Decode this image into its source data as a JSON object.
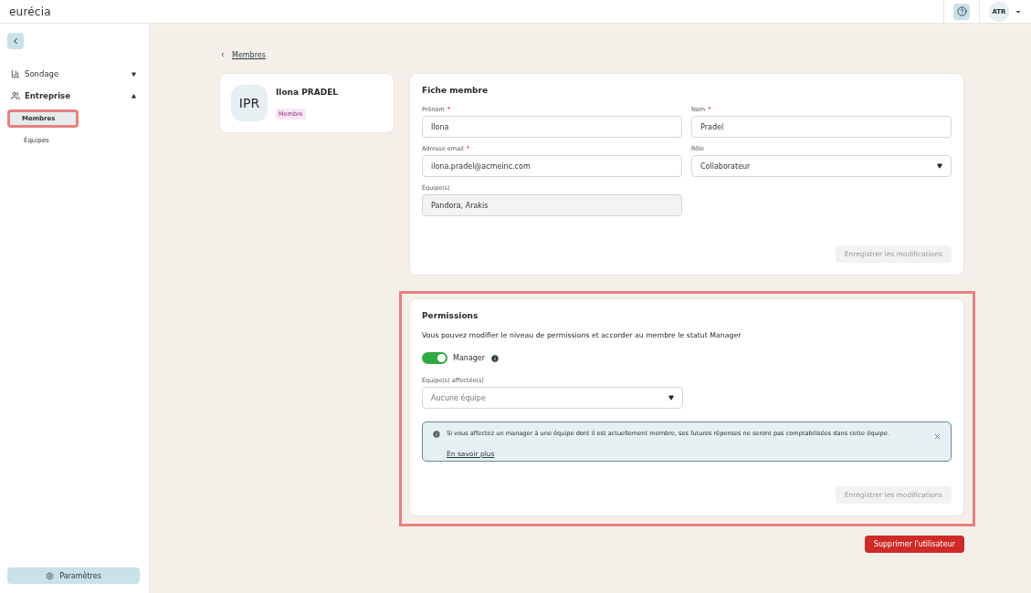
{
  "header": {
    "logo": "eurécia",
    "user_initials": "ATR"
  },
  "sidebar": {
    "items": [
      {
        "label": "Sondage",
        "expanded": false
      },
      {
        "label": "Entreprise",
        "expanded": true,
        "children": [
          {
            "label": "Membres",
            "selected": true,
            "highlighted": true
          },
          {
            "label": "Équipes",
            "selected": false,
            "highlighted": false
          }
        ]
      }
    ],
    "settings": "Paramètres"
  },
  "breadcrumb": "Membres",
  "profile": {
    "initials": "IPR",
    "name": "Ilona PRADEL",
    "badge": "Membre"
  },
  "member_form": {
    "title": "Fiche membre",
    "fields": [
      {
        "label": "Prénom",
        "required_mark": "*",
        "value": "Ilona",
        "kind": "text",
        "disabled": false
      },
      {
        "label": "Nom",
        "required_mark": "*",
        "value": "Pradel",
        "kind": "text",
        "disabled": false
      },
      {
        "label": "Adresse email",
        "required_mark": "*",
        "value": "ilona.pradel@acmeinc.com",
        "kind": "text",
        "disabled": false
      },
      {
        "label": "Rôle",
        "value": "Collaborateur",
        "kind": "select",
        "disabled": false
      },
      {
        "label": "Équipe(s)",
        "value": "Pandora, Arakis",
        "kind": "text",
        "disabled": true
      }
    ],
    "save": {
      "label": "Enregistrer les modifications",
      "disabled": true
    }
  },
  "permissions": {
    "title": "Permissions",
    "highlighted": true,
    "description": "Vous pouvez modifier le niveau de permissions et accorder au membre le statut Manager",
    "manager_toggle": {
      "label": "Manager",
      "on": true
    },
    "teams_field": {
      "label": "Équipe(s) affectée(s)",
      "placeholder": "Aucune équipe"
    },
    "notice": {
      "text": "Si vous affectez un manager à une équipe dont il est actuellement membre, ses futures réponses ne seront pas comptabilisées dans cette équipe.",
      "link": "En savoir plus"
    },
    "save": {
      "label": "Enregistrer les modifications",
      "disabled": true
    }
  },
  "delete_button": "Supprimer l'utilisateur"
}
